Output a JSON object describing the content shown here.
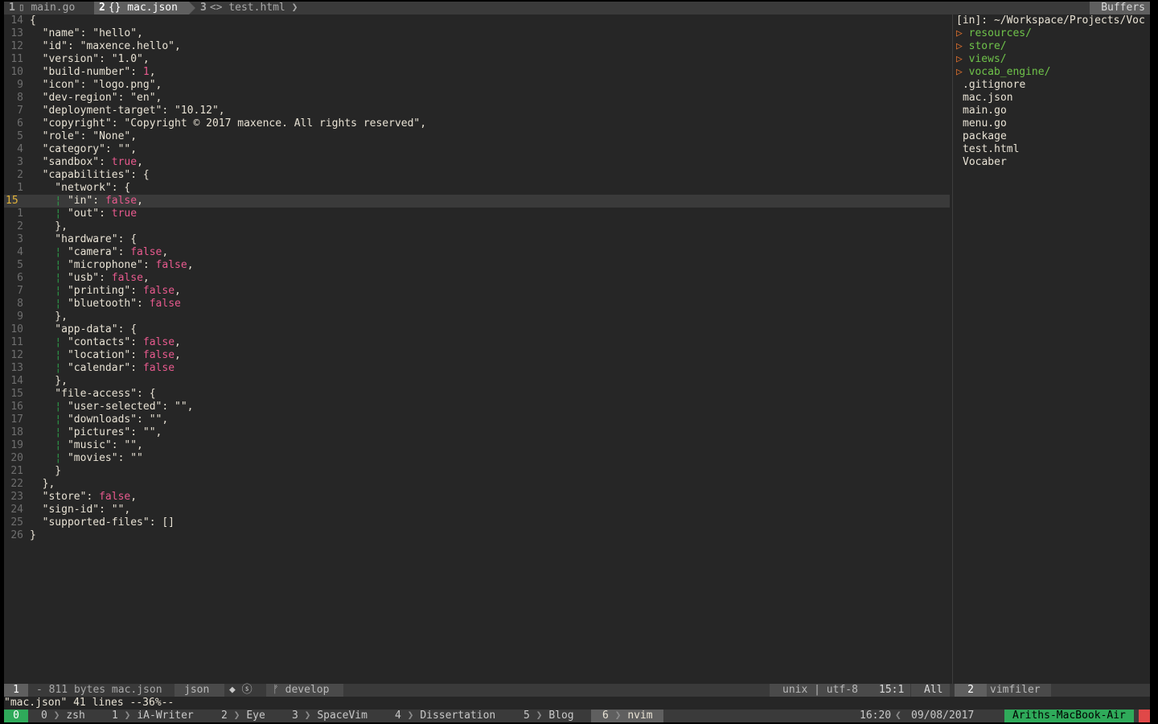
{
  "tabline": {
    "tabs": [
      {
        "num": "1",
        "icon": "file-icon",
        "label": "main.go"
      },
      {
        "num": "2",
        "icon": "json-icon",
        "label": "{} mac.json"
      },
      {
        "num": "3",
        "icon": "html-icon",
        "label": "<> test.html"
      }
    ],
    "buffers_label": "Buffers"
  },
  "editor": {
    "current_line": "15",
    "lines": [
      {
        "n": "14",
        "t": [
          [
            "{",
            ""
          ]
        ]
      },
      {
        "n": "13",
        "t": [
          [
            "  \"name\": \"hello\",",
            ""
          ]
        ]
      },
      {
        "n": "12",
        "t": [
          [
            "  \"id\": \"maxence.hello\",",
            ""
          ]
        ]
      },
      {
        "n": "11",
        "t": [
          [
            "  \"version\": \"1.0\",",
            ""
          ]
        ]
      },
      {
        "n": "10",
        "t": [
          [
            "  \"build-number\": ",
            ""
          ],
          [
            "1",
            "num"
          ],
          [
            ",",
            ""
          ]
        ]
      },
      {
        "n": "9",
        "t": [
          [
            "  \"icon\": \"logo.png\",",
            ""
          ]
        ]
      },
      {
        "n": "8",
        "t": [
          [
            "  \"dev-region\": \"en\",",
            ""
          ]
        ]
      },
      {
        "n": "7",
        "t": [
          [
            "  \"deployment-target\": \"10.12\",",
            ""
          ]
        ]
      },
      {
        "n": "6",
        "t": [
          [
            "  \"copyright\": \"Copyright © 2017 maxence. All rights reserved\",",
            ""
          ]
        ]
      },
      {
        "n": "5",
        "t": [
          [
            "  \"role\": \"None\",",
            ""
          ]
        ]
      },
      {
        "n": "4",
        "t": [
          [
            "  \"category\": \"\",",
            ""
          ]
        ]
      },
      {
        "n": "3",
        "t": [
          [
            "  \"sandbox\": ",
            ""
          ],
          [
            "true",
            "kw"
          ],
          [
            ",",
            ""
          ]
        ]
      },
      {
        "n": "2",
        "t": [
          [
            "  \"capabilities\": {",
            ""
          ]
        ]
      },
      {
        "n": "1",
        "t": [
          [
            "    \"network\": {",
            ""
          ]
        ]
      },
      {
        "n": "15",
        "t": [
          [
            "    ",
            ""
          ],
          [
            "¦",
            "guide"
          ],
          [
            " \"in\": ",
            ""
          ],
          [
            "false",
            "kw"
          ],
          [
            ",",
            ""
          ]
        ],
        "cursor": true
      },
      {
        "n": "1",
        "t": [
          [
            "    ",
            ""
          ],
          [
            "¦",
            "guide"
          ],
          [
            " \"out\": ",
            ""
          ],
          [
            "true",
            "kw"
          ]
        ]
      },
      {
        "n": "2",
        "t": [
          [
            "    },",
            ""
          ]
        ]
      },
      {
        "n": "3",
        "t": [
          [
            "    \"hardware\": {",
            ""
          ]
        ]
      },
      {
        "n": "4",
        "t": [
          [
            "    ",
            ""
          ],
          [
            "¦",
            "guide"
          ],
          [
            " \"camera\": ",
            ""
          ],
          [
            "false",
            "kw"
          ],
          [
            ",",
            ""
          ]
        ]
      },
      {
        "n": "5",
        "t": [
          [
            "    ",
            ""
          ],
          [
            "¦",
            "guide"
          ],
          [
            " \"microphone\": ",
            ""
          ],
          [
            "false",
            "kw"
          ],
          [
            ",",
            ""
          ]
        ]
      },
      {
        "n": "6",
        "t": [
          [
            "    ",
            ""
          ],
          [
            "¦",
            "guide"
          ],
          [
            " \"usb\": ",
            ""
          ],
          [
            "false",
            "kw"
          ],
          [
            ",",
            ""
          ]
        ]
      },
      {
        "n": "7",
        "t": [
          [
            "    ",
            ""
          ],
          [
            "¦",
            "guide"
          ],
          [
            " \"printing\": ",
            ""
          ],
          [
            "false",
            "kw"
          ],
          [
            ",",
            ""
          ]
        ]
      },
      {
        "n": "8",
        "t": [
          [
            "    ",
            ""
          ],
          [
            "¦",
            "guide"
          ],
          [
            " \"bluetooth\": ",
            ""
          ],
          [
            "false",
            "kw"
          ]
        ]
      },
      {
        "n": "9",
        "t": [
          [
            "    },",
            ""
          ]
        ]
      },
      {
        "n": "10",
        "t": [
          [
            "    \"app-data\": {",
            ""
          ]
        ]
      },
      {
        "n": "11",
        "t": [
          [
            "    ",
            ""
          ],
          [
            "¦",
            "guide"
          ],
          [
            " \"contacts\": ",
            ""
          ],
          [
            "false",
            "kw"
          ],
          [
            ",",
            ""
          ]
        ]
      },
      {
        "n": "12",
        "t": [
          [
            "    ",
            ""
          ],
          [
            "¦",
            "guide"
          ],
          [
            " \"location\": ",
            ""
          ],
          [
            "false",
            "kw"
          ],
          [
            ",",
            ""
          ]
        ]
      },
      {
        "n": "13",
        "t": [
          [
            "    ",
            ""
          ],
          [
            "¦",
            "guide"
          ],
          [
            " \"calendar\": ",
            ""
          ],
          [
            "false",
            "kw"
          ]
        ]
      },
      {
        "n": "14",
        "t": [
          [
            "    },",
            ""
          ]
        ]
      },
      {
        "n": "15",
        "t": [
          [
            "    \"file-access\": {",
            ""
          ]
        ]
      },
      {
        "n": "16",
        "t": [
          [
            "    ",
            ""
          ],
          [
            "¦",
            "guide"
          ],
          [
            " \"user-selected\": \"\",",
            ""
          ]
        ]
      },
      {
        "n": "17",
        "t": [
          [
            "    ",
            ""
          ],
          [
            "¦",
            "guide"
          ],
          [
            " \"downloads\": \"\",",
            ""
          ]
        ]
      },
      {
        "n": "18",
        "t": [
          [
            "    ",
            ""
          ],
          [
            "¦",
            "guide"
          ],
          [
            " \"pictures\": \"\",",
            ""
          ]
        ]
      },
      {
        "n": "19",
        "t": [
          [
            "    ",
            ""
          ],
          [
            "¦",
            "guide"
          ],
          [
            " \"music\": \"\",",
            ""
          ]
        ]
      },
      {
        "n": "20",
        "t": [
          [
            "    ",
            ""
          ],
          [
            "¦",
            "guide"
          ],
          [
            " \"movies\": \"\"",
            ""
          ]
        ]
      },
      {
        "n": "21",
        "t": [
          [
            "    }",
            ""
          ]
        ]
      },
      {
        "n": "22",
        "t": [
          [
            "  },",
            ""
          ]
        ]
      },
      {
        "n": "23",
        "t": [
          [
            "  \"store\": ",
            ""
          ],
          [
            "false",
            "kw"
          ],
          [
            ",",
            ""
          ]
        ]
      },
      {
        "n": "24",
        "t": [
          [
            "  \"sign-id\": \"\",",
            ""
          ]
        ]
      },
      {
        "n": "25",
        "t": [
          [
            "  \"supported-files\": []",
            ""
          ]
        ]
      },
      {
        "n": "26",
        "t": [
          [
            "}",
            ""
          ]
        ]
      }
    ]
  },
  "explorer": {
    "path": "[in]: ~/Workspace/Projects/Voc",
    "dirs": [
      "resources/",
      "store/",
      "views/",
      "vocab_engine/"
    ],
    "files": [
      ".gitignore",
      "mac.json",
      "main.go",
      "menu.go",
      "package",
      "test.html",
      "Vocaber"
    ]
  },
  "statusline": {
    "mode": "1",
    "file_info": "- 811 bytes mac.json",
    "filetype": "json",
    "flags": "◆ ⓢ",
    "branch_icon": "branch-icon",
    "branch": "develop",
    "format": "unix",
    "encoding": "utf-8",
    "position": "15:1",
    "scroll": "All",
    "right_mode": "2",
    "right_name": "vimfiler"
  },
  "cmdline": {
    "text": "\"mac.json\" 41 lines --36%--"
  },
  "tmux": {
    "session": "0",
    "windows": [
      {
        "index": "0",
        "name": "zsh"
      },
      {
        "index": "1",
        "name": "iA-Writer"
      },
      {
        "index": "2",
        "name": "Eye"
      },
      {
        "index": "3",
        "name": "SpaceVim"
      },
      {
        "index": "4",
        "name": "Dissertation"
      },
      {
        "index": "5",
        "name": "Blog"
      },
      {
        "index": "6",
        "name": "nvim"
      }
    ],
    "time": "16:20",
    "date": "09/08/2017",
    "host": "Ariths-MacBook-Air"
  },
  "colors": {
    "background": "#262626",
    "bar": "#3a3a3a",
    "keyword": "#e85a8e",
    "directory": "#6fc34a",
    "arrow": "#e8742e",
    "cursor_line_number": "#e2b33a",
    "tmux_green": "#2faa5a"
  }
}
